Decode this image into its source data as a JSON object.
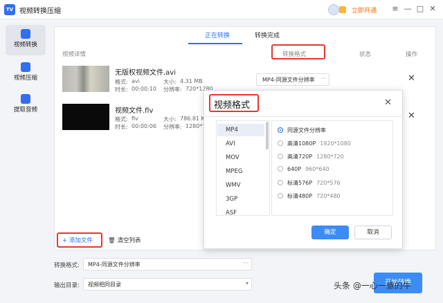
{
  "app": {
    "title": "视频转换压缩",
    "vip_link": "立即开通",
    "logo_text": "TV"
  },
  "window_controls": [
    "≡",
    "—",
    "□",
    "✕"
  ],
  "sidebar": {
    "items": [
      {
        "label": "视频转换",
        "icon": "video-convert-icon",
        "active": true
      },
      {
        "label": "视频压缩",
        "icon": "video-compress-icon",
        "active": false
      },
      {
        "label": "提取音频",
        "icon": "audio-extract-icon",
        "active": false
      }
    ]
  },
  "tabs": [
    {
      "label": "正在转换",
      "active": true
    },
    {
      "label": "转换完成",
      "active": false
    }
  ],
  "table_headers": {
    "details": "视频详情",
    "format": "转换格式",
    "status": "状态",
    "actions": "操作"
  },
  "files": [
    {
      "name": "无版权视频文件.avi",
      "format_label": "格式:",
      "format": "avi",
      "size_label": "大小:",
      "size": "4.31 MB",
      "duration_label": "时长:",
      "duration": "00:00:10",
      "resolution_label": "分辨率:",
      "resolution": "720*1280",
      "target_format": "MP4-同源文件分辨率"
    },
    {
      "name": "视频文件.flv",
      "format_label": "格式:",
      "format": "flv",
      "size_label": "大小:",
      "size": "786.81 K",
      "duration_label": "时长:",
      "duration": "00:00:06",
      "resolution_label": "分辨率:",
      "resolution": "1280*7"
    }
  ],
  "footer": {
    "add_file": "+ 添加文件",
    "clear_list": "清空列表"
  },
  "settings": {
    "format_label": "转换格式:",
    "format_value": "MP4-同源文件分辨率",
    "output_label": "输出目录:",
    "output_value": "视频相同目录",
    "start_button": "开始转换"
  },
  "dialog": {
    "title": "视频格式",
    "formats": [
      "MP4",
      "AVI",
      "MOV",
      "MPEG",
      "WMV",
      "3GP",
      "ASF"
    ],
    "selected_format": "MP4",
    "resolutions": [
      {
        "label": "同源文件分辨率",
        "sub": "",
        "selected": true
      },
      {
        "label": "高清1080P",
        "sub": "1920*1080",
        "selected": false
      },
      {
        "label": "高清720P",
        "sub": "1280*720",
        "selected": false
      },
      {
        "label": "640P",
        "sub": "960*640",
        "selected": false
      },
      {
        "label": "标清576P",
        "sub": "720*576",
        "selected": false
      },
      {
        "label": "标清480P",
        "sub": "720*480",
        "selected": false
      }
    ],
    "ok": "确定",
    "cancel": "取消"
  },
  "watermark": "头条 @一心一意的牛",
  "colors": {
    "accent": "#2f6ff0",
    "highlight": "#e5362f",
    "vip": "#ff6a00"
  }
}
